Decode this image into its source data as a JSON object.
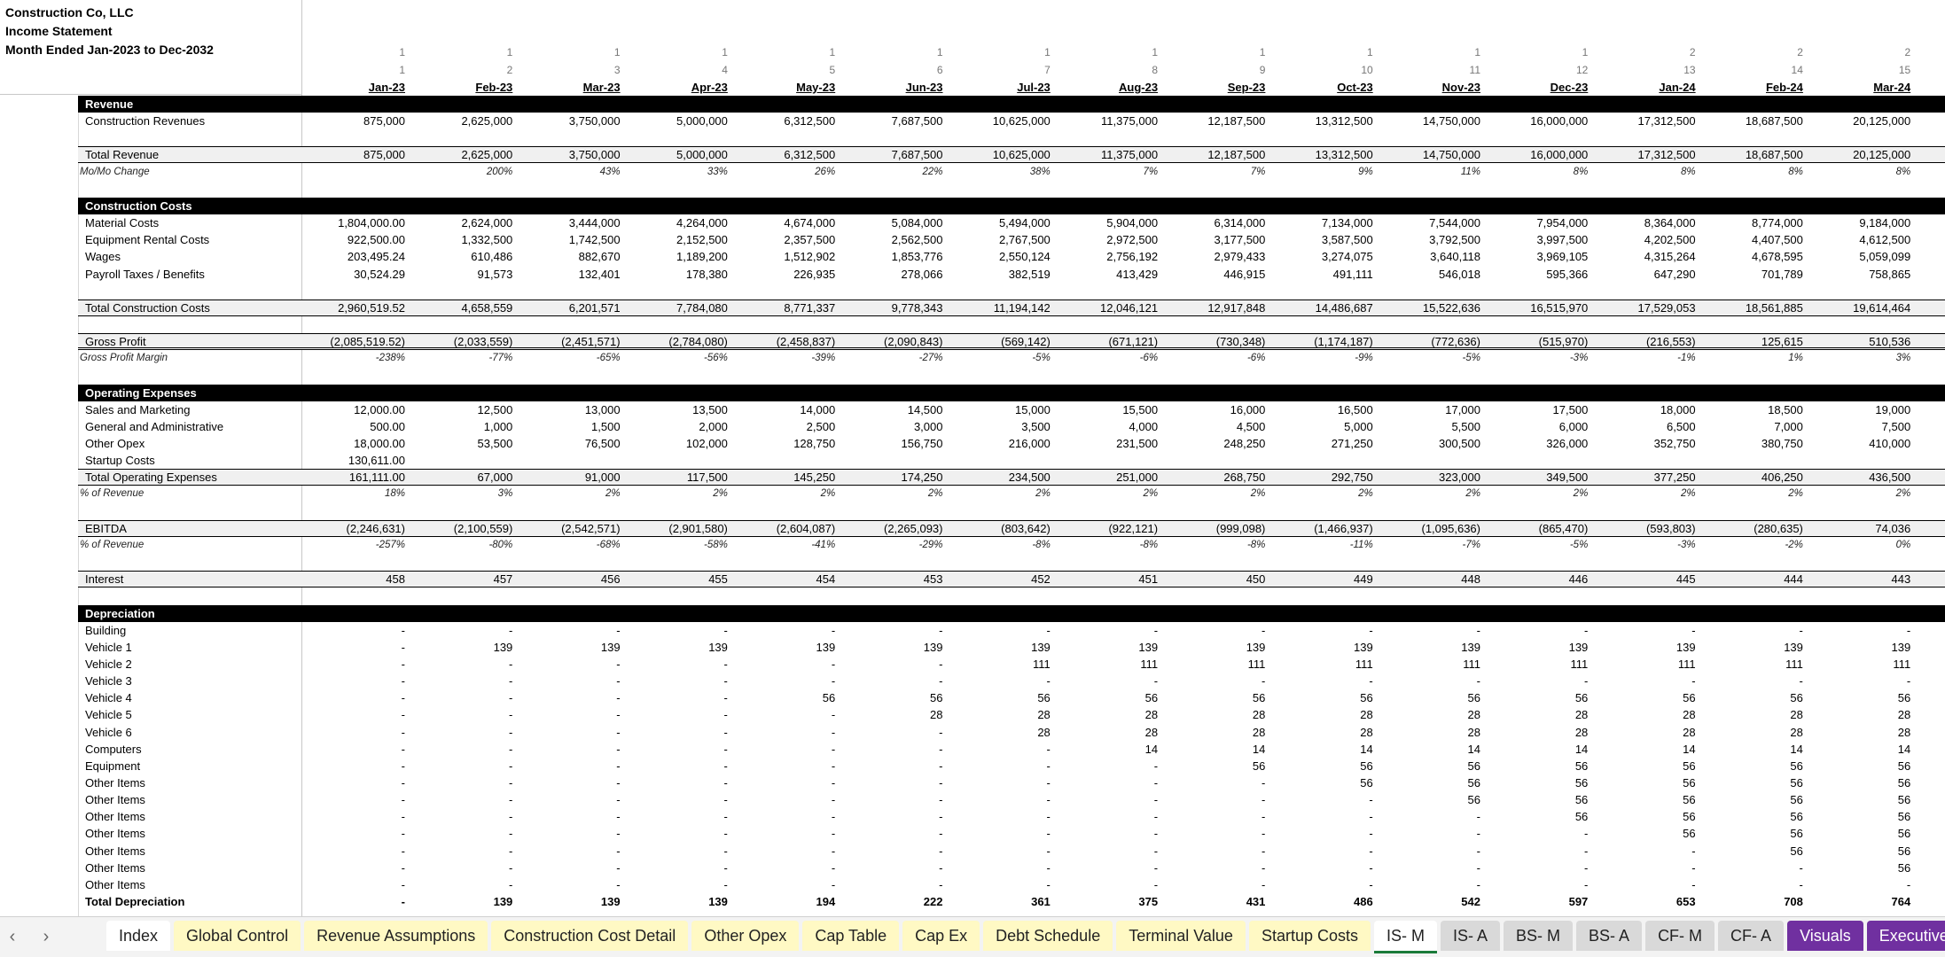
{
  "title": {
    "company": "Construction Co, LLC",
    "statement": "Income Statement",
    "period": "Month Ended Jan-2023 to Dec-2032"
  },
  "year_index": [
    "1",
    "1",
    "1",
    "1",
    "1",
    "1",
    "1",
    "1",
    "1",
    "1",
    "1",
    "1",
    "2",
    "2",
    "2"
  ],
  "month_index": [
    "1",
    "2",
    "3",
    "4",
    "5",
    "6",
    "7",
    "8",
    "9",
    "10",
    "11",
    "12",
    "13",
    "14",
    "15"
  ],
  "months": [
    "Jan-23",
    "Feb-23",
    "Mar-23",
    "Apr-23",
    "May-23",
    "Jun-23",
    "Jul-23",
    "Aug-23",
    "Sep-23",
    "Oct-23",
    "Nov-23",
    "Dec-23",
    "Jan-24",
    "Feb-24",
    "Mar-24"
  ],
  "rows": [
    {
      "type": "sechead",
      "label": "Revenue",
      "values": []
    },
    {
      "type": "normal",
      "label": "Construction Revenues",
      "values": [
        "875,000",
        "2,625,000",
        "3,750,000",
        "5,000,000",
        "6,312,500",
        "7,687,500",
        "10,625,000",
        "11,375,000",
        "12,187,500",
        "13,312,500",
        "14,750,000",
        "16,000,000",
        "17,312,500",
        "18,687,500",
        "20,125,000"
      ]
    },
    {
      "type": "blank",
      "label": "",
      "values": []
    },
    {
      "type": "total",
      "label": "Total Revenue",
      "values": [
        "875,000",
        "2,625,000",
        "3,750,000",
        "5,000,000",
        "6,312,500",
        "7,687,500",
        "10,625,000",
        "11,375,000",
        "12,187,500",
        "13,312,500",
        "14,750,000",
        "16,000,000",
        "17,312,500",
        "18,687,500",
        "20,125,000"
      ]
    },
    {
      "type": "italic",
      "label": "Mo/Mo Change",
      "values": [
        "",
        "200%",
        "43%",
        "33%",
        "26%",
        "22%",
        "38%",
        "7%",
        "7%",
        "9%",
        "11%",
        "8%",
        "8%",
        "8%",
        "8%"
      ]
    },
    {
      "type": "blank",
      "label": "",
      "values": []
    },
    {
      "type": "sechead",
      "label": "Construction Costs",
      "values": []
    },
    {
      "type": "normal",
      "label": "Material Costs",
      "values": [
        "1,804,000.00",
        "2,624,000",
        "3,444,000",
        "4,264,000",
        "4,674,000",
        "5,084,000",
        "5,494,000",
        "5,904,000",
        "6,314,000",
        "7,134,000",
        "7,544,000",
        "7,954,000",
        "8,364,000",
        "8,774,000",
        "9,184,000"
      ]
    },
    {
      "type": "normal",
      "label": "Equipment Rental Costs",
      "values": [
        "922,500.00",
        "1,332,500",
        "1,742,500",
        "2,152,500",
        "2,357,500",
        "2,562,500",
        "2,767,500",
        "2,972,500",
        "3,177,500",
        "3,587,500",
        "3,792,500",
        "3,997,500",
        "4,202,500",
        "4,407,500",
        "4,612,500"
      ]
    },
    {
      "type": "normal",
      "label": "Wages",
      "values": [
        "203,495.24",
        "610,486",
        "882,670",
        "1,189,200",
        "1,512,902",
        "1,853,776",
        "2,550,124",
        "2,756,192",
        "2,979,433",
        "3,274,075",
        "3,640,118",
        "3,969,105",
        "4,315,264",
        "4,678,595",
        "5,059,099"
      ]
    },
    {
      "type": "normal",
      "label": "Payroll Taxes / Benefits",
      "values": [
        "30,524.29",
        "91,573",
        "132,401",
        "178,380",
        "226,935",
        "278,066",
        "382,519",
        "413,429",
        "446,915",
        "491,111",
        "546,018",
        "595,366",
        "647,290",
        "701,789",
        "758,865"
      ]
    },
    {
      "type": "blank",
      "label": "",
      "values": []
    },
    {
      "type": "total",
      "label": "Total Construction Costs",
      "values": [
        "2,960,519.52",
        "4,658,559",
        "6,201,571",
        "7,784,080",
        "8,771,337",
        "9,778,343",
        "11,194,142",
        "12,046,121",
        "12,917,848",
        "14,486,687",
        "15,522,636",
        "16,515,970",
        "17,529,053",
        "18,561,885",
        "19,614,464"
      ]
    },
    {
      "type": "blank",
      "label": "",
      "values": []
    },
    {
      "type": "gp",
      "label": "Gross Profit",
      "values": [
        "(2,085,519.52)",
        "(2,033,559)",
        "(2,451,571)",
        "(2,784,080)",
        "(2,458,837)",
        "(2,090,843)",
        "(569,142)",
        "(671,121)",
        "(730,348)",
        "(1,174,187)",
        "(772,636)",
        "(515,970)",
        "(216,553)",
        "125,615",
        "510,536"
      ]
    },
    {
      "type": "italic",
      "label": "Gross Profit Margin",
      "values": [
        "-238%",
        "-77%",
        "-65%",
        "-56%",
        "-39%",
        "-27%",
        "-5%",
        "-6%",
        "-6%",
        "-9%",
        "-5%",
        "-3%",
        "-1%",
        "1%",
        "3%"
      ]
    },
    {
      "type": "blank",
      "label": "",
      "values": []
    },
    {
      "type": "sechead",
      "label": "Operating Expenses",
      "values": []
    },
    {
      "type": "normal",
      "label": "Sales and Marketing",
      "values": [
        "12,000.00",
        "12,500",
        "13,000",
        "13,500",
        "14,000",
        "14,500",
        "15,000",
        "15,500",
        "16,000",
        "16,500",
        "17,000",
        "17,500",
        "18,000",
        "18,500",
        "19,000"
      ]
    },
    {
      "type": "normal",
      "label": "General and Administrative",
      "values": [
        "500.00",
        "1,000",
        "1,500",
        "2,000",
        "2,500",
        "3,000",
        "3,500",
        "4,000",
        "4,500",
        "5,000",
        "5,500",
        "6,000",
        "6,500",
        "7,000",
        "7,500"
      ]
    },
    {
      "type": "normal",
      "label": "Other Opex",
      "values": [
        "18,000.00",
        "53,500",
        "76,500",
        "102,000",
        "128,750",
        "156,750",
        "216,000",
        "231,500",
        "248,250",
        "271,250",
        "300,500",
        "326,000",
        "352,750",
        "380,750",
        "410,000"
      ]
    },
    {
      "type": "normal",
      "label": "Startup Costs",
      "values": [
        "130,611.00",
        "",
        "",
        "",
        "",
        "",
        "",
        "",
        "",
        "",
        "",
        "",
        "",
        "",
        ""
      ]
    },
    {
      "type": "total",
      "label": "Total Operating Expenses",
      "values": [
        "161,111.00",
        "67,000",
        "91,000",
        "117,500",
        "145,250",
        "174,250",
        "234,500",
        "251,000",
        "268,750",
        "292,750",
        "323,000",
        "349,500",
        "377,250",
        "406,250",
        "436,500"
      ]
    },
    {
      "type": "italic",
      "label": "% of Revenue",
      "values": [
        "18%",
        "3%",
        "2%",
        "2%",
        "2%",
        "2%",
        "2%",
        "2%",
        "2%",
        "2%",
        "2%",
        "2%",
        "2%",
        "2%",
        "2%"
      ]
    },
    {
      "type": "blank",
      "label": "",
      "values": []
    },
    {
      "type": "total",
      "label": "EBITDA",
      "values": [
        "(2,246,631)",
        "(2,100,559)",
        "(2,542,571)",
        "(2,901,580)",
        "(2,604,087)",
        "(2,265,093)",
        "(803,642)",
        "(922,121)",
        "(999,098)",
        "(1,466,937)",
        "(1,095,636)",
        "(865,470)",
        "(593,803)",
        "(280,635)",
        "74,036"
      ]
    },
    {
      "type": "italic",
      "label": "% of Revenue",
      "values": [
        "-257%",
        "-80%",
        "-68%",
        "-58%",
        "-41%",
        "-29%",
        "-8%",
        "-8%",
        "-8%",
        "-11%",
        "-7%",
        "-5%",
        "-3%",
        "-2%",
        "0%"
      ]
    },
    {
      "type": "blank",
      "label": "",
      "values": []
    },
    {
      "type": "total",
      "label": "Interest",
      "values": [
        "458",
        "457",
        "456",
        "455",
        "454",
        "453",
        "452",
        "451",
        "450",
        "449",
        "448",
        "446",
        "445",
        "444",
        "443"
      ]
    },
    {
      "type": "blank",
      "label": "",
      "values": []
    },
    {
      "type": "sechead",
      "label": "Depreciation",
      "values": []
    },
    {
      "type": "normal",
      "label": "Building",
      "values": [
        "-",
        "-",
        "-",
        "-",
        "-",
        "-",
        "-",
        "-",
        "-",
        "-",
        "-",
        "-",
        "-",
        "-",
        "-"
      ]
    },
    {
      "type": "normal",
      "label": "Vehicle 1",
      "values": [
        "-",
        "139",
        "139",
        "139",
        "139",
        "139",
        "139",
        "139",
        "139",
        "139",
        "139",
        "139",
        "139",
        "139",
        "139"
      ]
    },
    {
      "type": "normal",
      "label": "Vehicle 2",
      "values": [
        "-",
        "-",
        "-",
        "-",
        "-",
        "-",
        "111",
        "111",
        "111",
        "111",
        "111",
        "111",
        "111",
        "111",
        "111"
      ]
    },
    {
      "type": "normal",
      "label": "Vehicle 3",
      "values": [
        "-",
        "-",
        "-",
        "-",
        "-",
        "-",
        "-",
        "-",
        "-",
        "-",
        "-",
        "-",
        "-",
        "-",
        "-"
      ]
    },
    {
      "type": "normal",
      "label": "Vehicle 4",
      "values": [
        "-",
        "-",
        "-",
        "-",
        "56",
        "56",
        "56",
        "56",
        "56",
        "56",
        "56",
        "56",
        "56",
        "56",
        "56"
      ]
    },
    {
      "type": "normal",
      "label": "Vehicle 5",
      "values": [
        "-",
        "-",
        "-",
        "-",
        "-",
        "28",
        "28",
        "28",
        "28",
        "28",
        "28",
        "28",
        "28",
        "28",
        "28"
      ]
    },
    {
      "type": "normal",
      "label": "Vehicle 6",
      "values": [
        "-",
        "-",
        "-",
        "-",
        "-",
        "-",
        "28",
        "28",
        "28",
        "28",
        "28",
        "28",
        "28",
        "28",
        "28"
      ]
    },
    {
      "type": "normal",
      "label": "Computers",
      "values": [
        "-",
        "-",
        "-",
        "-",
        "-",
        "-",
        "-",
        "14",
        "14",
        "14",
        "14",
        "14",
        "14",
        "14",
        "14"
      ]
    },
    {
      "type": "normal",
      "label": "Equipment",
      "values": [
        "-",
        "-",
        "-",
        "-",
        "-",
        "-",
        "-",
        "-",
        "56",
        "56",
        "56",
        "56",
        "56",
        "56",
        "56"
      ]
    },
    {
      "type": "normal",
      "label": "Other Items",
      "values": [
        "-",
        "-",
        "-",
        "-",
        "-",
        "-",
        "-",
        "-",
        "-",
        "56",
        "56",
        "56",
        "56",
        "56",
        "56"
      ]
    },
    {
      "type": "normal",
      "label": "Other Items",
      "values": [
        "-",
        "-",
        "-",
        "-",
        "-",
        "-",
        "-",
        "-",
        "-",
        "-",
        "56",
        "56",
        "56",
        "56",
        "56"
      ]
    },
    {
      "type": "normal",
      "label": "Other Items",
      "values": [
        "-",
        "-",
        "-",
        "-",
        "-",
        "-",
        "-",
        "-",
        "-",
        "-",
        "-",
        "56",
        "56",
        "56",
        "56"
      ]
    },
    {
      "type": "normal",
      "label": "Other Items",
      "values": [
        "-",
        "-",
        "-",
        "-",
        "-",
        "-",
        "-",
        "-",
        "-",
        "-",
        "-",
        "-",
        "56",
        "56",
        "56"
      ]
    },
    {
      "type": "normal",
      "label": "Other Items",
      "values": [
        "-",
        "-",
        "-",
        "-",
        "-",
        "-",
        "-",
        "-",
        "-",
        "-",
        "-",
        "-",
        "-",
        "56",
        "56"
      ]
    },
    {
      "type": "normal",
      "label": "Other Items",
      "values": [
        "-",
        "-",
        "-",
        "-",
        "-",
        "-",
        "-",
        "-",
        "-",
        "-",
        "-",
        "-",
        "-",
        "-",
        "56"
      ]
    },
    {
      "type": "normal",
      "label": "Other Items",
      "values": [
        "-",
        "-",
        "-",
        "-",
        "-",
        "-",
        "-",
        "-",
        "-",
        "-",
        "-",
        "-",
        "-",
        "-",
        "-"
      ]
    },
    {
      "type": "bold",
      "label": "Total Depreciation",
      "values": [
        "-",
        "139",
        "139",
        "139",
        "194",
        "222",
        "361",
        "375",
        "431",
        "486",
        "542",
        "597",
        "653",
        "708",
        "764"
      ]
    }
  ],
  "tabs": [
    {
      "label": "Index",
      "color": "#ffffff",
      "text": "#222222"
    },
    {
      "label": "Global Control",
      "color": "#fff9c4",
      "text": "#222222"
    },
    {
      "label": "Revenue Assumptions",
      "color": "#fff9c4",
      "text": "#222222"
    },
    {
      "label": "Construction Cost Detail",
      "color": "#fff9c4",
      "text": "#222222"
    },
    {
      "label": "Other Opex",
      "color": "#fff9c4",
      "text": "#222222"
    },
    {
      "label": "Cap Table",
      "color": "#fff9c4",
      "text": "#222222"
    },
    {
      "label": "Cap Ex",
      "color": "#fff9c4",
      "text": "#222222"
    },
    {
      "label": "Debt Schedule",
      "color": "#fff9c4",
      "text": "#222222"
    },
    {
      "label": "Terminal Value",
      "color": "#fff9c4",
      "text": "#222222"
    },
    {
      "label": "Startup Costs",
      "color": "#fff9c4",
      "text": "#222222"
    },
    {
      "label": "IS- M",
      "color": "#ffffff",
      "text": "#222222",
      "active": true
    },
    {
      "label": "IS- A",
      "color": "#d9d9d9",
      "text": "#222222"
    },
    {
      "label": "BS- M",
      "color": "#d9d9d9",
      "text": "#222222"
    },
    {
      "label": "BS- A",
      "color": "#d9d9d9",
      "text": "#222222"
    },
    {
      "label": "CF- M",
      "color": "#d9d9d9",
      "text": "#222222"
    },
    {
      "label": "CF- A",
      "color": "#d9d9d9",
      "text": "#222222"
    },
    {
      "label": "Visuals",
      "color": "#7030a0",
      "text": "#ffffff"
    },
    {
      "label": "Executive Summ",
      "color": "#7030a0",
      "text": "#ffffff"
    }
  ],
  "nav": {
    "prev": "‹",
    "next": "›"
  }
}
